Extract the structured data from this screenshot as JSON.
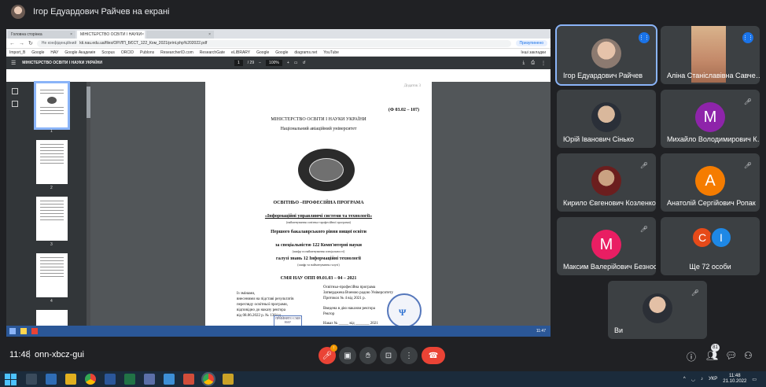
{
  "presenter": {
    "text": "Ігор Едуардович Райчев на екрані"
  },
  "browser": {
    "tabs": [
      {
        "label": "Головна сторінка"
      },
      {
        "label": "МІНІСТЕРСТВО ОСВІТИ І НАУКИ"
      },
      {
        "label": ""
      }
    ],
    "url_prefix": "Не конфіденційний",
    "url": "kti.nau.edu.ua/files/OP/ЛП_БЄСТ_122_Ком_2021/print.php%202022.pdf",
    "profile": "Призупинено",
    "bookmarks": [
      "Import_B",
      "Google",
      "НАУ",
      "Google Академія",
      "Scopus",
      "ORCID",
      "Publons",
      "ResearcherID.com",
      "ResearchGate",
      "eLIBRARY",
      "Google",
      "Google",
      "diagrams.net",
      "YouTube"
    ],
    "bookmarks_right": "Інші закладки"
  },
  "pdf": {
    "title": "МІНІСТЕРСТВО ОСВІТИ І НАУКИ УКРАЇНИ",
    "page_current": "1",
    "page_total": "/ 29",
    "zoom": "100%",
    "thumb_numbers": [
      "1",
      "2",
      "3",
      "4"
    ],
    "doc": {
      "corner": "Додаток 3",
      "code": "(Ф 03.02 – 107)",
      "ministry": "МІНІСТЕРСТВО ОСВІТИ І НАУКИ УКРАЇНИ",
      "university": "Національний авіаційний університет",
      "program_type": "ОСВІТНЬО –ПРОФЕСІЙНА ПРОГРАМА",
      "program_name": "«Інформаційні управляючі системи та технології»",
      "program_name_hint": "(найменування освітньо-професійної програми)",
      "level": "Першого бакалаврського рівня вищої освіти",
      "specialty": "за спеціальністю 122 Комп'ютерні науки",
      "specialty_hint": "(шифр та найменування спеціальності)",
      "field": "галузі знань  12 Інформаційні технології",
      "field_hint": "(шифр та найменування галузі)",
      "doc_code": "СМЯ НАУ ОПП 09.01.03 – 04 – 2021",
      "left_notes": [
        "Із змінами,",
        "внесеними на підставі результатів",
        "перегляду освітньої програми,",
        "відповідно до наказу ректора",
        "від 08.06.2022 р. № 136/од"
      ],
      "right_notes": [
        "Освітньо-професійна програма",
        "Затверджена Вченою радою Університету",
        "Протокол № 4  від 2021 р.",
        "",
        "Введена в дію наказом ректора",
        "Ректор",
        "",
        "Наказ № _____ від _______ 2021"
      ],
      "box_stamp": "ПРИЙНЯТО СМЯ НАУ"
    },
    "inner_clock": "11:47"
  },
  "participants": [
    {
      "name": "Ігор Едуардович Райчев",
      "kind": "photo",
      "mic": "speaking"
    },
    {
      "name": "Аліна Станіславівна Савченко",
      "kind": "photo-wide",
      "mic": "speaking"
    },
    {
      "name": "Юрій Іванович Сінько",
      "kind": "photo",
      "mic": "muted"
    },
    {
      "name": "Михайло Володимирович Ко...",
      "kind": "letter",
      "letter": "M",
      "color": "#8e24aa",
      "mic": "muted"
    },
    {
      "name": "Кирило Євгенович Козленко",
      "kind": "photo",
      "mic": "muted"
    },
    {
      "name": "Анатолій Сергійович Ропак",
      "kind": "letter",
      "letter": "A",
      "color": "#f57c00",
      "mic": "muted"
    },
    {
      "name": "Максим Валерійович Безнос",
      "kind": "letter",
      "letter": "M",
      "color": "#e91e63",
      "mic": "muted"
    },
    {
      "name": "Ще 72 особи",
      "kind": "pair",
      "letters": [
        "C",
        "I"
      ],
      "colors": [
        "#e64a19",
        "#1e88e5"
      ],
      "mic": "none"
    },
    {
      "name": "Ви",
      "kind": "photo",
      "mic": "muted"
    }
  ],
  "meet": {
    "time": "11:48",
    "separator": "|",
    "code": "onn-xbcz-gui",
    "reactions_badge": "!",
    "people_count": "81"
  },
  "tray": {
    "lang": "УКР",
    "time": "11:48",
    "date": "21.10.2022"
  },
  "colors": {
    "bg": "#202124",
    "tile": "#3c4043",
    "hangup": "#ea4335",
    "accent": "#1a73e8"
  }
}
